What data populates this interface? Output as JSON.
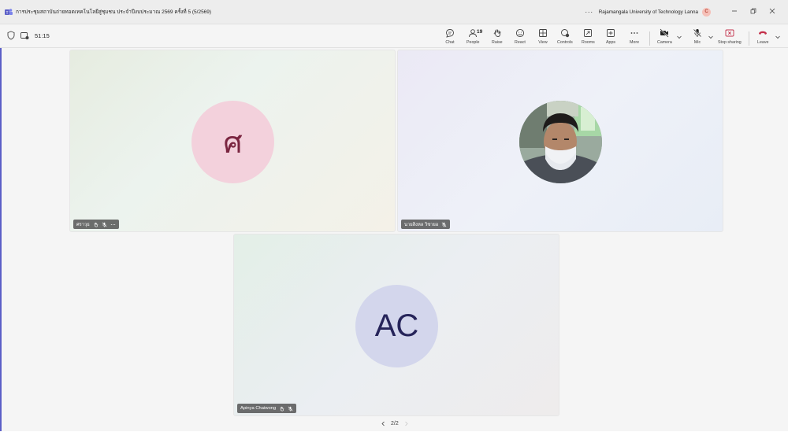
{
  "window": {
    "title": "การประชุมสถาบันถ่ายทอดเทคโนโลยีสู่ชุมชน ประจำปีงบประมาณ 2569 ครั้งที่ 5 (5/2569)",
    "more": "···",
    "organization": "Rajamangala University of Technology Lanna",
    "org_initial": "C"
  },
  "meeting": {
    "timer": "51:15",
    "people_count": "19"
  },
  "toolbar": {
    "chat": "Chat",
    "people": "People",
    "raise": "Raise",
    "react": "React",
    "view": "View",
    "controls": "Controls",
    "rooms": "Rooms",
    "apps": "Apps",
    "more": "More",
    "camera": "Camera",
    "mic": "Mic",
    "stop_sharing": "Stop sharing",
    "leave": "Leave"
  },
  "participants": [
    {
      "name": "ศราวุธ",
      "avatar_text": "ศ",
      "avatar_color": "#f3d1dc"
    },
    {
      "name": "นายสิงหล วิชายอ"
    },
    {
      "name": "Apinya Chaiwong",
      "avatar_text": "AC",
      "avatar_color": "#d3d6ec"
    }
  ],
  "pager": {
    "label": "2/2"
  },
  "colors": {
    "accent": "#5b5fc7",
    "leave": "#c4314b"
  }
}
